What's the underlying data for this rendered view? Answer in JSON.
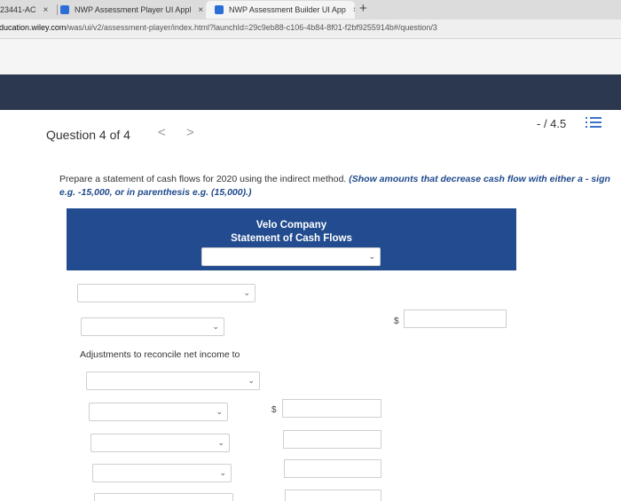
{
  "browser": {
    "tabs": [
      {
        "label": "23441-AC",
        "close": "×"
      },
      {
        "label": "NWP Assessment Player UI Appl",
        "close": "×"
      },
      {
        "label": "NWP Assessment Builder UI App",
        "close": "×"
      }
    ],
    "new_tab": "+",
    "url_host": "education.wiley.com",
    "url_path": "/was/ui/v2/assessment-player/index.html?launchId=29c9eb88-c106-4b84-8f01-f2bf9255914b#/question/3"
  },
  "question": {
    "title": "Question 4 of 4",
    "prev": "<",
    "next": ">",
    "score": "- / 4.5"
  },
  "instructions": {
    "text": "Prepare a statement of cash flows for 2020 using the indirect method. ",
    "emphasis": "(Show amounts that decrease cash flow with either a - sign e.g. -15,000, or in parenthesis e.g. (15,000).)"
  },
  "statement": {
    "company": "Velo Company",
    "name": "Statement of Cash Flows",
    "adjustments_label": "Adjustments to reconcile net income to",
    "currency_symbol": "$"
  },
  "icons": {
    "chevron": "chevron-down-icon",
    "list": "list-icon"
  }
}
